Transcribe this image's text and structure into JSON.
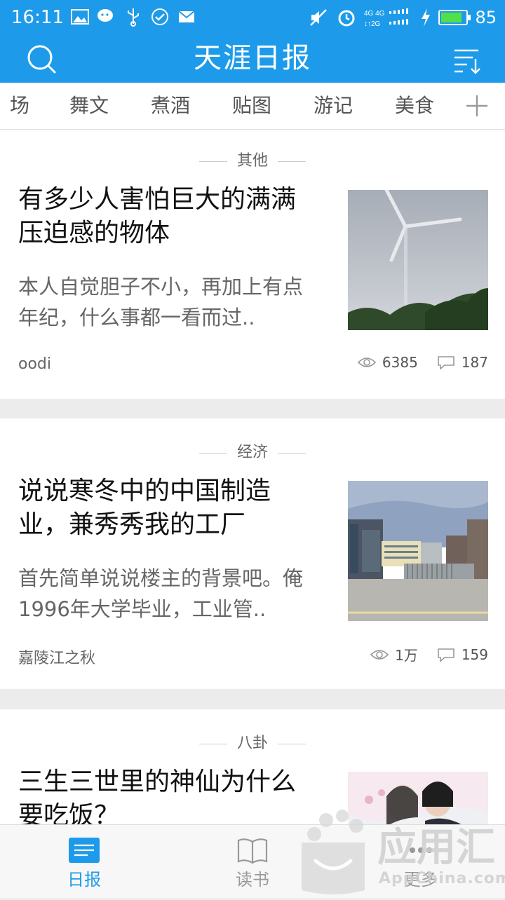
{
  "status_bar": {
    "time": "16:11",
    "battery": "85",
    "battery_level": 0.85
  },
  "header": {
    "title": "天涯日报",
    "search_icon": "search-icon",
    "sort_icon": "sort-icon"
  },
  "tabs": [
    "场",
    "舞文",
    "煮酒",
    "贴图",
    "游记",
    "美食"
  ],
  "articles": [
    {
      "category": "其他",
      "title": "有多少人害怕巨大的满满压迫感的物体",
      "summary": "本人自觉胆子不小，再加上有点年纪，什么事都一看而过..",
      "author": "oodi",
      "views": "6385",
      "comments": "187"
    },
    {
      "category": "经济",
      "title": "说说寒冬中的中国制造业，兼秀秀我的工厂",
      "summary": "首先简单说说楼主的背景吧。俺1996年大学毕业，工业管..",
      "author": "嘉陵江之秋",
      "views": "1万",
      "comments": "159"
    },
    {
      "category": "八卦",
      "title": "三生三世里的神仙为什么要吃饭？"
    }
  ],
  "bottom_nav": [
    {
      "label": "日报",
      "icon": "news-icon",
      "active": true
    },
    {
      "label": "读书",
      "icon": "book-icon",
      "active": false
    },
    {
      "label": "更多",
      "icon": "more-icon",
      "active": false
    }
  ],
  "watermark": {
    "brand": "应用汇",
    "site": "AppChina.com"
  },
  "colors": {
    "accent": "#1d9bea",
    "active_nav": "#1d9bea",
    "inactive_nav": "#999999"
  }
}
